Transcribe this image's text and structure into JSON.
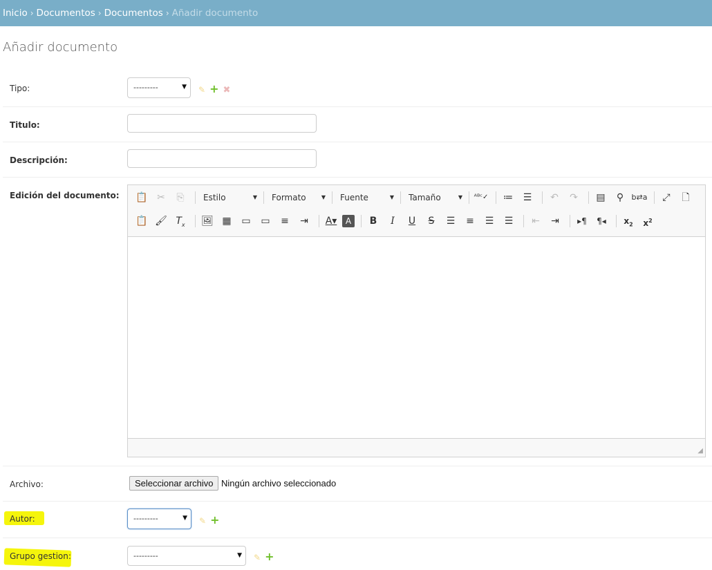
{
  "breadcrumbs": {
    "items": [
      "Inicio",
      "Documentos",
      "Documentos"
    ],
    "current": "Añadir documento",
    "separator": "›"
  },
  "page_title": "Añadir documento",
  "form": {
    "tipo": {
      "label": "Tipo:",
      "value": "---------"
    },
    "titulo": {
      "label": "Titulo:",
      "value": ""
    },
    "descripcion": {
      "label": "Descripción:",
      "value": ""
    },
    "edicion": {
      "label": "Edición del documento:"
    },
    "archivo": {
      "label": "Archivo:",
      "button": "Seleccionar archivo",
      "status": "Ningún archivo seleccionado"
    },
    "autor": {
      "label": "Autor:",
      "value": "---------"
    },
    "grupo": {
      "label": "Grupo gestion:",
      "value": "---------"
    }
  },
  "editor": {
    "combos": {
      "estilo": "Estilo",
      "formato": "Formato",
      "fuente": "Fuente",
      "tamano": "Tamaño"
    }
  },
  "colors": {
    "breadcrumb_bg": "#79aec8",
    "add_icon": "#70bf2b",
    "edit_icon": "#f2d98b",
    "delete_icon": "#ebb8b8",
    "highlight": "#f5f50c"
  }
}
